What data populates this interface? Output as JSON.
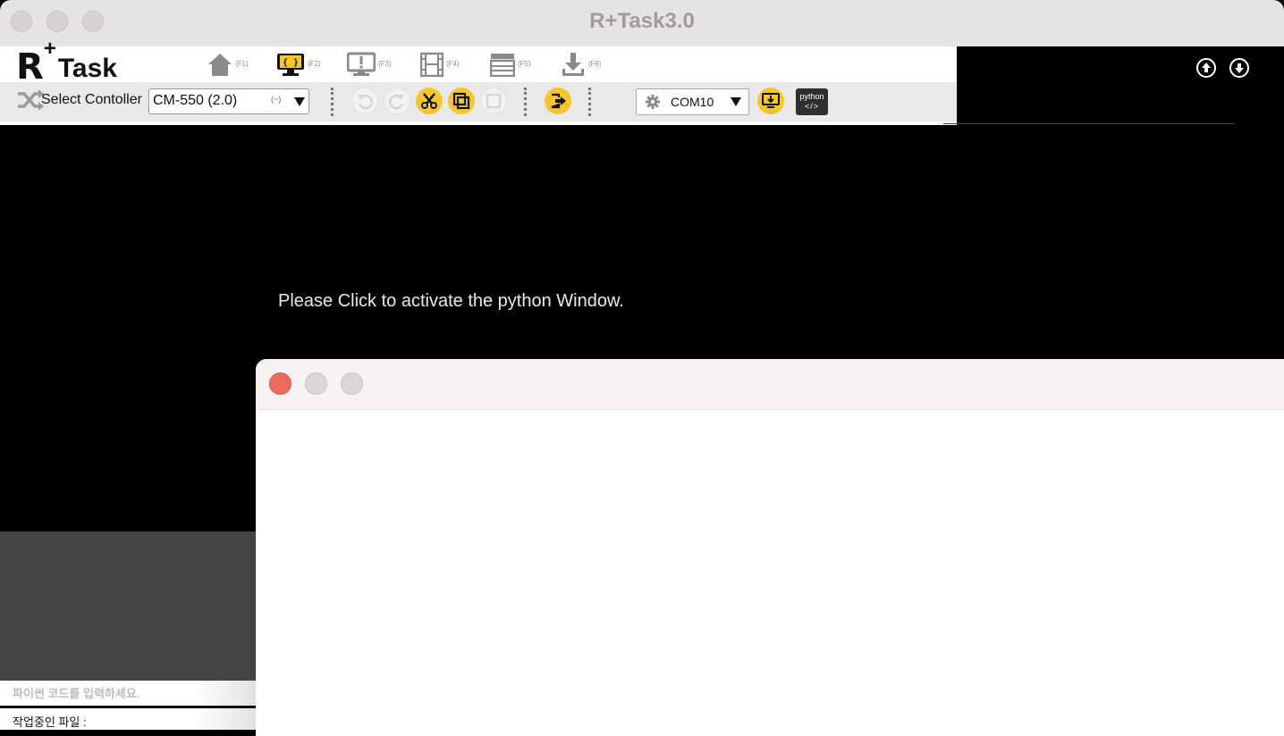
{
  "window": {
    "title": "R+Task3.0"
  },
  "logo": {
    "r": "R",
    "plus": "+",
    "task": "Task"
  },
  "nav": [
    {
      "icon": "home-icon",
      "key": "(F1)"
    },
    {
      "icon": "code-monitor-icon",
      "key": "(F2)"
    },
    {
      "icon": "alert-monitor-icon",
      "key": "(F3)"
    },
    {
      "icon": "film-icon",
      "key": "(F4)"
    },
    {
      "icon": "clapper-icon",
      "key": "(F5)"
    },
    {
      "icon": "download-icon",
      "key": "(F6)"
    }
  ],
  "controller": {
    "label": "Select Contoller",
    "value": "CM-550 (2.0)",
    "hint": "(~)"
  },
  "port": {
    "value": "COM10"
  },
  "python_button": {
    "line1": "python",
    "line2": "</>"
  },
  "main": {
    "message": "Please Click to activate the python Window."
  },
  "editor": {
    "placeholder": "파이썬 코드를 입력하세요.",
    "file_label": "작업중인 파일 :"
  },
  "colors": {
    "accent": "#f7c62a",
    "close": "#ec6a5e"
  }
}
